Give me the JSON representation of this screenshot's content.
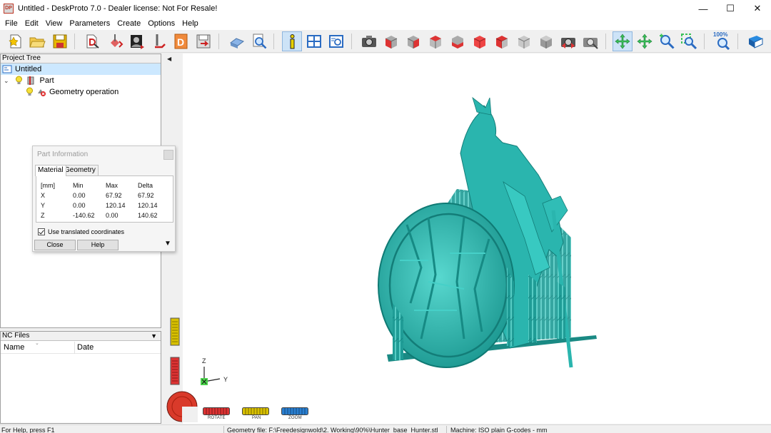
{
  "window": {
    "title": "Untitled - DeskProto 7.0 - Dealer license: Not For Resale!",
    "logo": "DP",
    "controls": [
      "minimize",
      "maximize",
      "close"
    ]
  },
  "menu": [
    "File",
    "Edit",
    "View",
    "Parameters",
    "Create",
    "Options",
    "Help"
  ],
  "toolbar": {
    "icons": [
      "new-icon",
      "open-icon",
      "save-icon",
      "wizard-icon",
      "cutter-icon",
      "image-icon",
      "drill-icon",
      "dxf-icon",
      "export-icon",
      "part-icon",
      "search-icon",
      "info-icon",
      "layout-icon",
      "preview-icon",
      "camera-icon",
      "view-iso-icon",
      "view-front-icon",
      "view-back-icon",
      "view-left-icon",
      "view-right-icon",
      "view-top-icon",
      "view-bottom-icon",
      "view-iso2-icon",
      "reset-view-icon",
      "render-icon",
      "rotate-icon",
      "pan-icon",
      "zoom-icon",
      "zoom-window-icon",
      "zoom-100-icon",
      "help-book-icon"
    ],
    "zoom_label": "100%"
  },
  "project_tree": {
    "header": "Project Tree",
    "items": [
      {
        "label": "Untitled",
        "level": 0
      },
      {
        "label": "Part",
        "level": 1
      },
      {
        "label": "Geometry operation",
        "level": 2
      }
    ]
  },
  "nc_files": {
    "header": "NC Files",
    "columns": [
      "Name",
      "Date"
    ]
  },
  "part_info": {
    "title": "Part Information",
    "tabs": [
      "Material",
      "Geometry"
    ],
    "active_tab": "Material",
    "headers": [
      "[mm]",
      "Min",
      "Max",
      "Delta"
    ],
    "rows": [
      {
        "axis": "X",
        "min": "0.00",
        "max": "67.92",
        "delta": "67.92"
      },
      {
        "axis": "Y",
        "min": "0.00",
        "max": "120.14",
        "delta": "120.14"
      },
      {
        "axis": "Z",
        "min": "-140.62",
        "max": "0.00",
        "delta": "140.62"
      }
    ],
    "checkbox_label": "Use translated coordinates",
    "checkbox_checked": true,
    "close_label": "Close",
    "help_label": "Help"
  },
  "viewport": {
    "model_color": "#2fb7b0",
    "axes": {
      "z": "Z",
      "y": "Y",
      "x": "X"
    }
  },
  "controls": {
    "rotate": "ROTATE",
    "pan": "PAN",
    "zoom": "ZOOM"
  },
  "status": {
    "help": "For Help, press F1",
    "geometry": "Geometry file: F:\\Freedesignwold\\2. Working\\90%\\Hunter_base_Hunter.stl",
    "machine": "Machine: ISO plain G-codes - mm"
  }
}
